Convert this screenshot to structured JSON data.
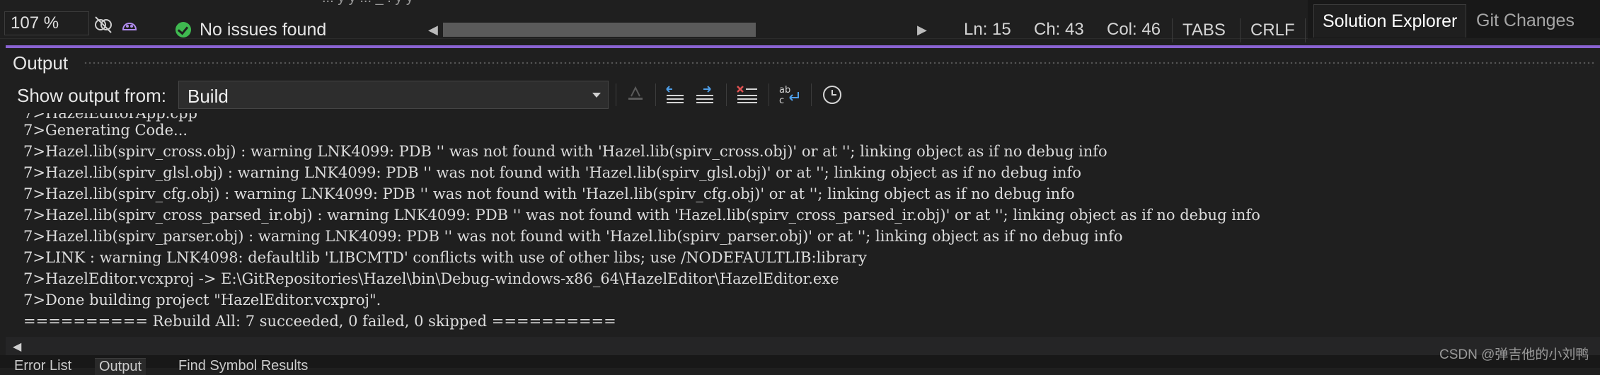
{
  "top_strip": {
    "clip_text": "...   y   y   ...  _   .   y y"
  },
  "status_bar": {
    "zoom": "107 %",
    "issues": "No issues found",
    "ln": "Ln: 15",
    "ch": "Ch: 43",
    "col": "Col: 46",
    "indent": "TABS",
    "line_ending": "CRLF"
  },
  "right_tabs": [
    {
      "label": "Solution Explorer"
    },
    {
      "label": "Git Changes"
    }
  ],
  "output_panel": {
    "title": "Output",
    "show_output_from_label": "Show output from:",
    "source": "Build",
    "lines": [
      "7>Generating Code...",
      "7>Hazel.lib(spirv_cross.obj) : warning LNK4099: PDB '' was not found with 'Hazel.lib(spirv_cross.obj)' or at ''; linking object as if no debug info",
      "7>Hazel.lib(spirv_glsl.obj) : warning LNK4099: PDB '' was not found with 'Hazel.lib(spirv_glsl.obj)' or at ''; linking object as if no debug info",
      "7>Hazel.lib(spirv_cfg.obj) : warning LNK4099: PDB '' was not found with 'Hazel.lib(spirv_cfg.obj)' or at ''; linking object as if no debug info",
      "7>Hazel.lib(spirv_cross_parsed_ir.obj) : warning LNK4099: PDB '' was not found with 'Hazel.lib(spirv_cross_parsed_ir.obj)' or at ''; linking object as if no debug info",
      "7>Hazel.lib(spirv_parser.obj) : warning LNK4099: PDB '' was not found with 'Hazel.lib(spirv_parser.obj)' or at ''; linking object as if no debug info",
      "7>LINK : warning LNK4098: defaultlib 'LIBCMTD' conflicts with use of other libs; use /NODEFAULTLIB:library",
      "7>HazelEditor.vcxproj -> E:\\GitRepositories\\Hazel\\bin\\Debug-windows-x86_64\\HazelEditor\\HazelEditor.exe",
      "7>Done building project \"HazelEditor.vcxproj\".",
      "========== Rebuild All: 7 succeeded, 0 failed, 0 skipped =========="
    ]
  },
  "bottom_tabs": [
    {
      "label": "Error List"
    },
    {
      "label": "Output"
    },
    {
      "label": "Find Symbol Results"
    }
  ],
  "watermark": "CSDN @弹吉他的小刘鸭",
  "colors": {
    "accent": "#8a63d2",
    "ok_green": "#3fb950",
    "icon_blue": "#4f9fe8",
    "icon_red": "#e05252"
  }
}
